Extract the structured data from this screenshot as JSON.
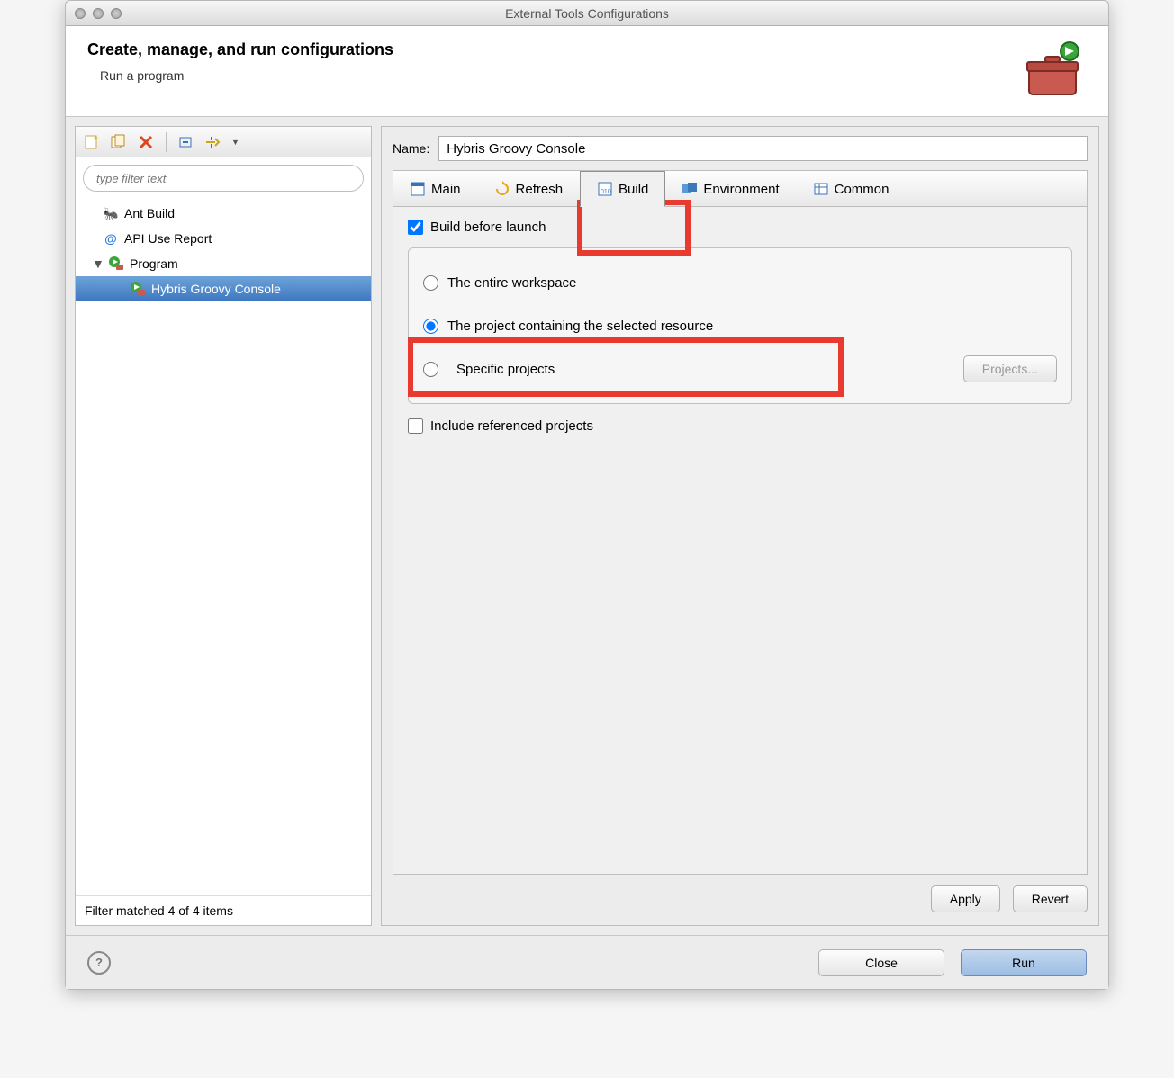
{
  "window": {
    "title": "External Tools Configurations"
  },
  "header": {
    "heading": "Create, manage, and run configurations",
    "subheading": "Run a program"
  },
  "sidebar": {
    "filter_placeholder": "type filter text",
    "items": [
      {
        "label": "Ant Build"
      },
      {
        "label": "API Use Report"
      },
      {
        "label": "Program",
        "expanded": true,
        "children": [
          {
            "label": "Hybris Groovy Console"
          }
        ]
      }
    ],
    "status": "Filter matched 4 of 4 items"
  },
  "main": {
    "name_label": "Name:",
    "name_value": "Hybris Groovy Console",
    "tabs": [
      {
        "label": "Main"
      },
      {
        "label": "Refresh"
      },
      {
        "label": "Build",
        "active": true
      },
      {
        "label": "Environment"
      },
      {
        "label": "Common"
      }
    ],
    "build": {
      "before_launch_label": "Build before launch",
      "before_launch_checked": true,
      "radios": {
        "entire_workspace": "The entire workspace",
        "project_selected": "The project containing the selected resource",
        "specific_projects": "Specific projects",
        "selected_index": 1
      },
      "projects_button": "Projects...",
      "include_referenced_label": "Include referenced projects",
      "include_referenced_checked": false
    },
    "apply": "Apply",
    "revert": "Revert"
  },
  "footer": {
    "close": "Close",
    "run": "Run"
  }
}
